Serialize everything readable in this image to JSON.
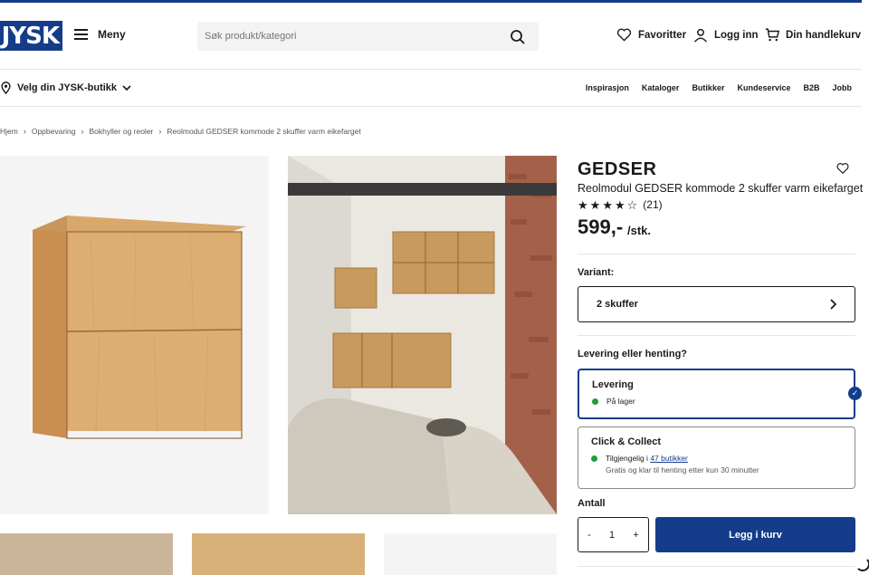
{
  "brand_colors": {
    "primary": "#143c8a",
    "in_stock": "#1f9d3a"
  },
  "header": {
    "logo_text": "JYSK",
    "menu_label": "Meny",
    "search_placeholder": "Søk produkt/kategori",
    "favorites_label": "Favoritter",
    "login_label": "Logg inn",
    "cart_label": "Din handlekurv"
  },
  "subnav": {
    "store_label": "Velg din JYSK-butikk",
    "links": [
      "Inspirasjon",
      "Kataloger",
      "Butikker",
      "Kundeservice",
      "B2B",
      "Jobb"
    ]
  },
  "breadcrumb": [
    "Hjem",
    "Oppbevaring",
    "Bokhyller og reoler",
    "Reolmodul GEDSER kommode 2 skuffer varm eikefarget"
  ],
  "product": {
    "brand": "GEDSER",
    "name": "Reolmodul GEDSER kommode 2 skuffer varm eikefarget",
    "rating": 4,
    "rating_max": 5,
    "review_count": "(21)",
    "price": "599,-",
    "price_unit": "/stk.",
    "variant_label": "Variant:",
    "variant_value": "2 skuffer",
    "delivery_question": "Levering eller henting?",
    "delivery": {
      "title": "Levering",
      "status": "På lager",
      "selected": true
    },
    "collect": {
      "title": "Click & Collect",
      "status_prefix": "Tilgjengelig i",
      "status_link": "47 butikker",
      "note": "Gratis og klar til henting etter kun 30 minutter"
    },
    "quantity_label": "Antall",
    "quantity": "1",
    "minus": "-",
    "plus": "+",
    "add_to_cart": "Legg i kurv"
  }
}
